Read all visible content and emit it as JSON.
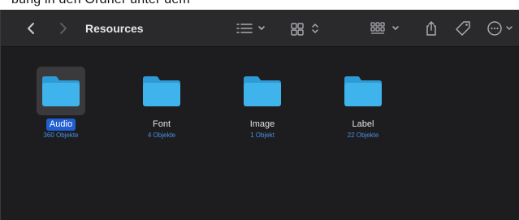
{
  "page_caption": "bung in den Ordner unter dem",
  "window": {
    "title": "Resources"
  },
  "toolbar": {
    "back": "chevron-left-icon",
    "forward": "chevron-right-icon",
    "list_view": "list-view-icon",
    "grid_view": "grid-view-icon",
    "group": "group-icon",
    "share": "share-icon",
    "tag": "tag-icon",
    "more": "more-icon"
  },
  "colors": {
    "folder": "#3fb3ec",
    "selection": "#1f5fd1",
    "count_text": "#4a8fe3"
  },
  "folders": [
    {
      "name": "Audio",
      "count": "360 Objekte",
      "selected": true
    },
    {
      "name": "Font",
      "count": "4 Objekte",
      "selected": false
    },
    {
      "name": "Image",
      "count": "1 Objekt",
      "selected": false
    },
    {
      "name": "Label",
      "count": "22 Objekte",
      "selected": false
    }
  ]
}
